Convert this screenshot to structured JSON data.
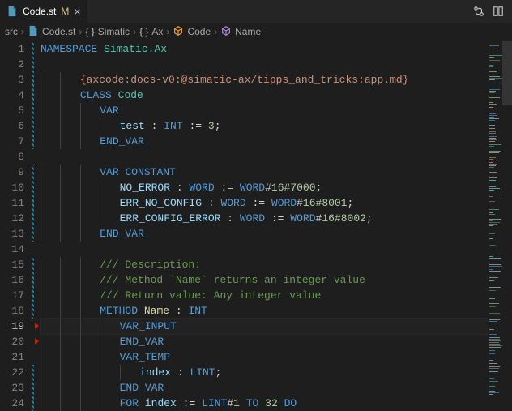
{
  "tab": {
    "filename": "Code.st",
    "modified_indicator": "M"
  },
  "breadcrumbs": {
    "items": [
      {
        "label": "src",
        "icon": ""
      },
      {
        "label": "Code.st",
        "icon": "file"
      },
      {
        "label": "Simatic",
        "icon": "braces"
      },
      {
        "label": "Ax",
        "icon": "braces"
      },
      {
        "label": "Code",
        "icon": "struct"
      },
      {
        "label": "Name",
        "icon": "cube"
      }
    ]
  },
  "editor": {
    "current_line": 19,
    "visible_start": 1,
    "visible_end": 24,
    "modified_ranges": [
      [
        1,
        7
      ],
      [
        9,
        13
      ],
      [
        15,
        18
      ],
      [
        22,
        24
      ]
    ],
    "lines": {
      "l1": {
        "indent": 0,
        "tokens": [
          [
            "kw",
            "NAMESPACE"
          ],
          [
            "plain",
            " "
          ],
          [
            "ns",
            "Simatic.Ax"
          ]
        ]
      },
      "l2": {
        "indent": 0,
        "tokens": []
      },
      "l3": {
        "indent": 2,
        "tokens": [
          [
            "str",
            "{axcode:docs-v0:@simatic-ax/tipps_and_tricks:app.md}"
          ]
        ]
      },
      "l4": {
        "indent": 2,
        "tokens": [
          [
            "kw",
            "CLASS"
          ],
          [
            "plain",
            " "
          ],
          [
            "ns",
            "Code"
          ]
        ]
      },
      "l5": {
        "indent": 3,
        "tokens": [
          [
            "kw",
            "VAR"
          ]
        ]
      },
      "l6": {
        "indent": 4,
        "tokens": [
          [
            "id",
            "test"
          ],
          [
            "plain",
            " : "
          ],
          [
            "type",
            "INT"
          ],
          [
            "plain",
            " := "
          ],
          [
            "num",
            "3"
          ],
          [
            "plain",
            ";"
          ]
        ]
      },
      "l7": {
        "indent": 3,
        "tokens": [
          [
            "kw",
            "END_VAR"
          ]
        ]
      },
      "l8": {
        "indent": 0,
        "tokens": []
      },
      "l9": {
        "indent": 3,
        "tokens": [
          [
            "kw",
            "VAR"
          ],
          [
            "plain",
            " "
          ],
          [
            "kw",
            "CONSTANT"
          ]
        ]
      },
      "l10": {
        "indent": 4,
        "tokens": [
          [
            "id",
            "NO_ERROR"
          ],
          [
            "plain",
            " : "
          ],
          [
            "type",
            "WORD"
          ],
          [
            "plain",
            " := "
          ],
          [
            "type",
            "WORD"
          ],
          [
            "plain",
            "#"
          ],
          [
            "num",
            "16#7000"
          ],
          [
            "plain",
            ";"
          ]
        ]
      },
      "l11": {
        "indent": 4,
        "tokens": [
          [
            "id",
            "ERR_NO_CONFIG"
          ],
          [
            "plain",
            " : "
          ],
          [
            "type",
            "WORD"
          ],
          [
            "plain",
            " := "
          ],
          [
            "type",
            "WORD"
          ],
          [
            "plain",
            "#"
          ],
          [
            "num",
            "16#8001"
          ],
          [
            "plain",
            ";"
          ]
        ]
      },
      "l12": {
        "indent": 4,
        "tokens": [
          [
            "id",
            "ERR_CONFIG_ERROR"
          ],
          [
            "plain",
            " : "
          ],
          [
            "type",
            "WORD"
          ],
          [
            "plain",
            " := "
          ],
          [
            "type",
            "WORD"
          ],
          [
            "plain",
            "#"
          ],
          [
            "num",
            "16#8002"
          ],
          [
            "plain",
            ";"
          ]
        ]
      },
      "l13": {
        "indent": 3,
        "tokens": [
          [
            "kw",
            "END_VAR"
          ]
        ]
      },
      "l14": {
        "indent": 0,
        "tokens": []
      },
      "l15": {
        "indent": 3,
        "tokens": [
          [
            "comment",
            "/// Description:"
          ]
        ]
      },
      "l16": {
        "indent": 3,
        "tokens": [
          [
            "comment",
            "/// Method `Name` returns an integer value"
          ]
        ]
      },
      "l17": {
        "indent": 3,
        "tokens": [
          [
            "comment",
            "/// Return value: Any integer value"
          ]
        ]
      },
      "l18": {
        "indent": 3,
        "tokens": [
          [
            "kw",
            "METHOD"
          ],
          [
            "plain",
            " "
          ],
          [
            "fn",
            "Name"
          ],
          [
            "plain",
            " : "
          ],
          [
            "type",
            "INT"
          ]
        ]
      },
      "l19": {
        "indent": 4,
        "tokens": [
          [
            "kw",
            "VAR_INPUT"
          ]
        ]
      },
      "l20": {
        "indent": 4,
        "tokens": [
          [
            "kw",
            "END_VAR"
          ]
        ]
      },
      "l21": {
        "indent": 4,
        "tokens": [
          [
            "kw",
            "VAR_TEMP"
          ]
        ]
      },
      "l22": {
        "indent": 5,
        "tokens": [
          [
            "id",
            "index"
          ],
          [
            "plain",
            " : "
          ],
          [
            "type",
            "LINT"
          ],
          [
            "plain",
            ";"
          ]
        ]
      },
      "l23": {
        "indent": 4,
        "tokens": [
          [
            "kw",
            "END_VAR"
          ]
        ]
      },
      "l24": {
        "indent": 4,
        "tokens": [
          [
            "kw",
            "FOR"
          ],
          [
            "plain",
            " "
          ],
          [
            "id",
            "index"
          ],
          [
            "plain",
            " := "
          ],
          [
            "type",
            "LINT"
          ],
          [
            "plain",
            "#"
          ],
          [
            "num",
            "1"
          ],
          [
            "plain",
            " "
          ],
          [
            "kw",
            "TO"
          ],
          [
            "plain",
            " "
          ],
          [
            "num",
            "32"
          ],
          [
            "plain",
            " "
          ],
          [
            "kw",
            "DO"
          ]
        ]
      }
    }
  }
}
